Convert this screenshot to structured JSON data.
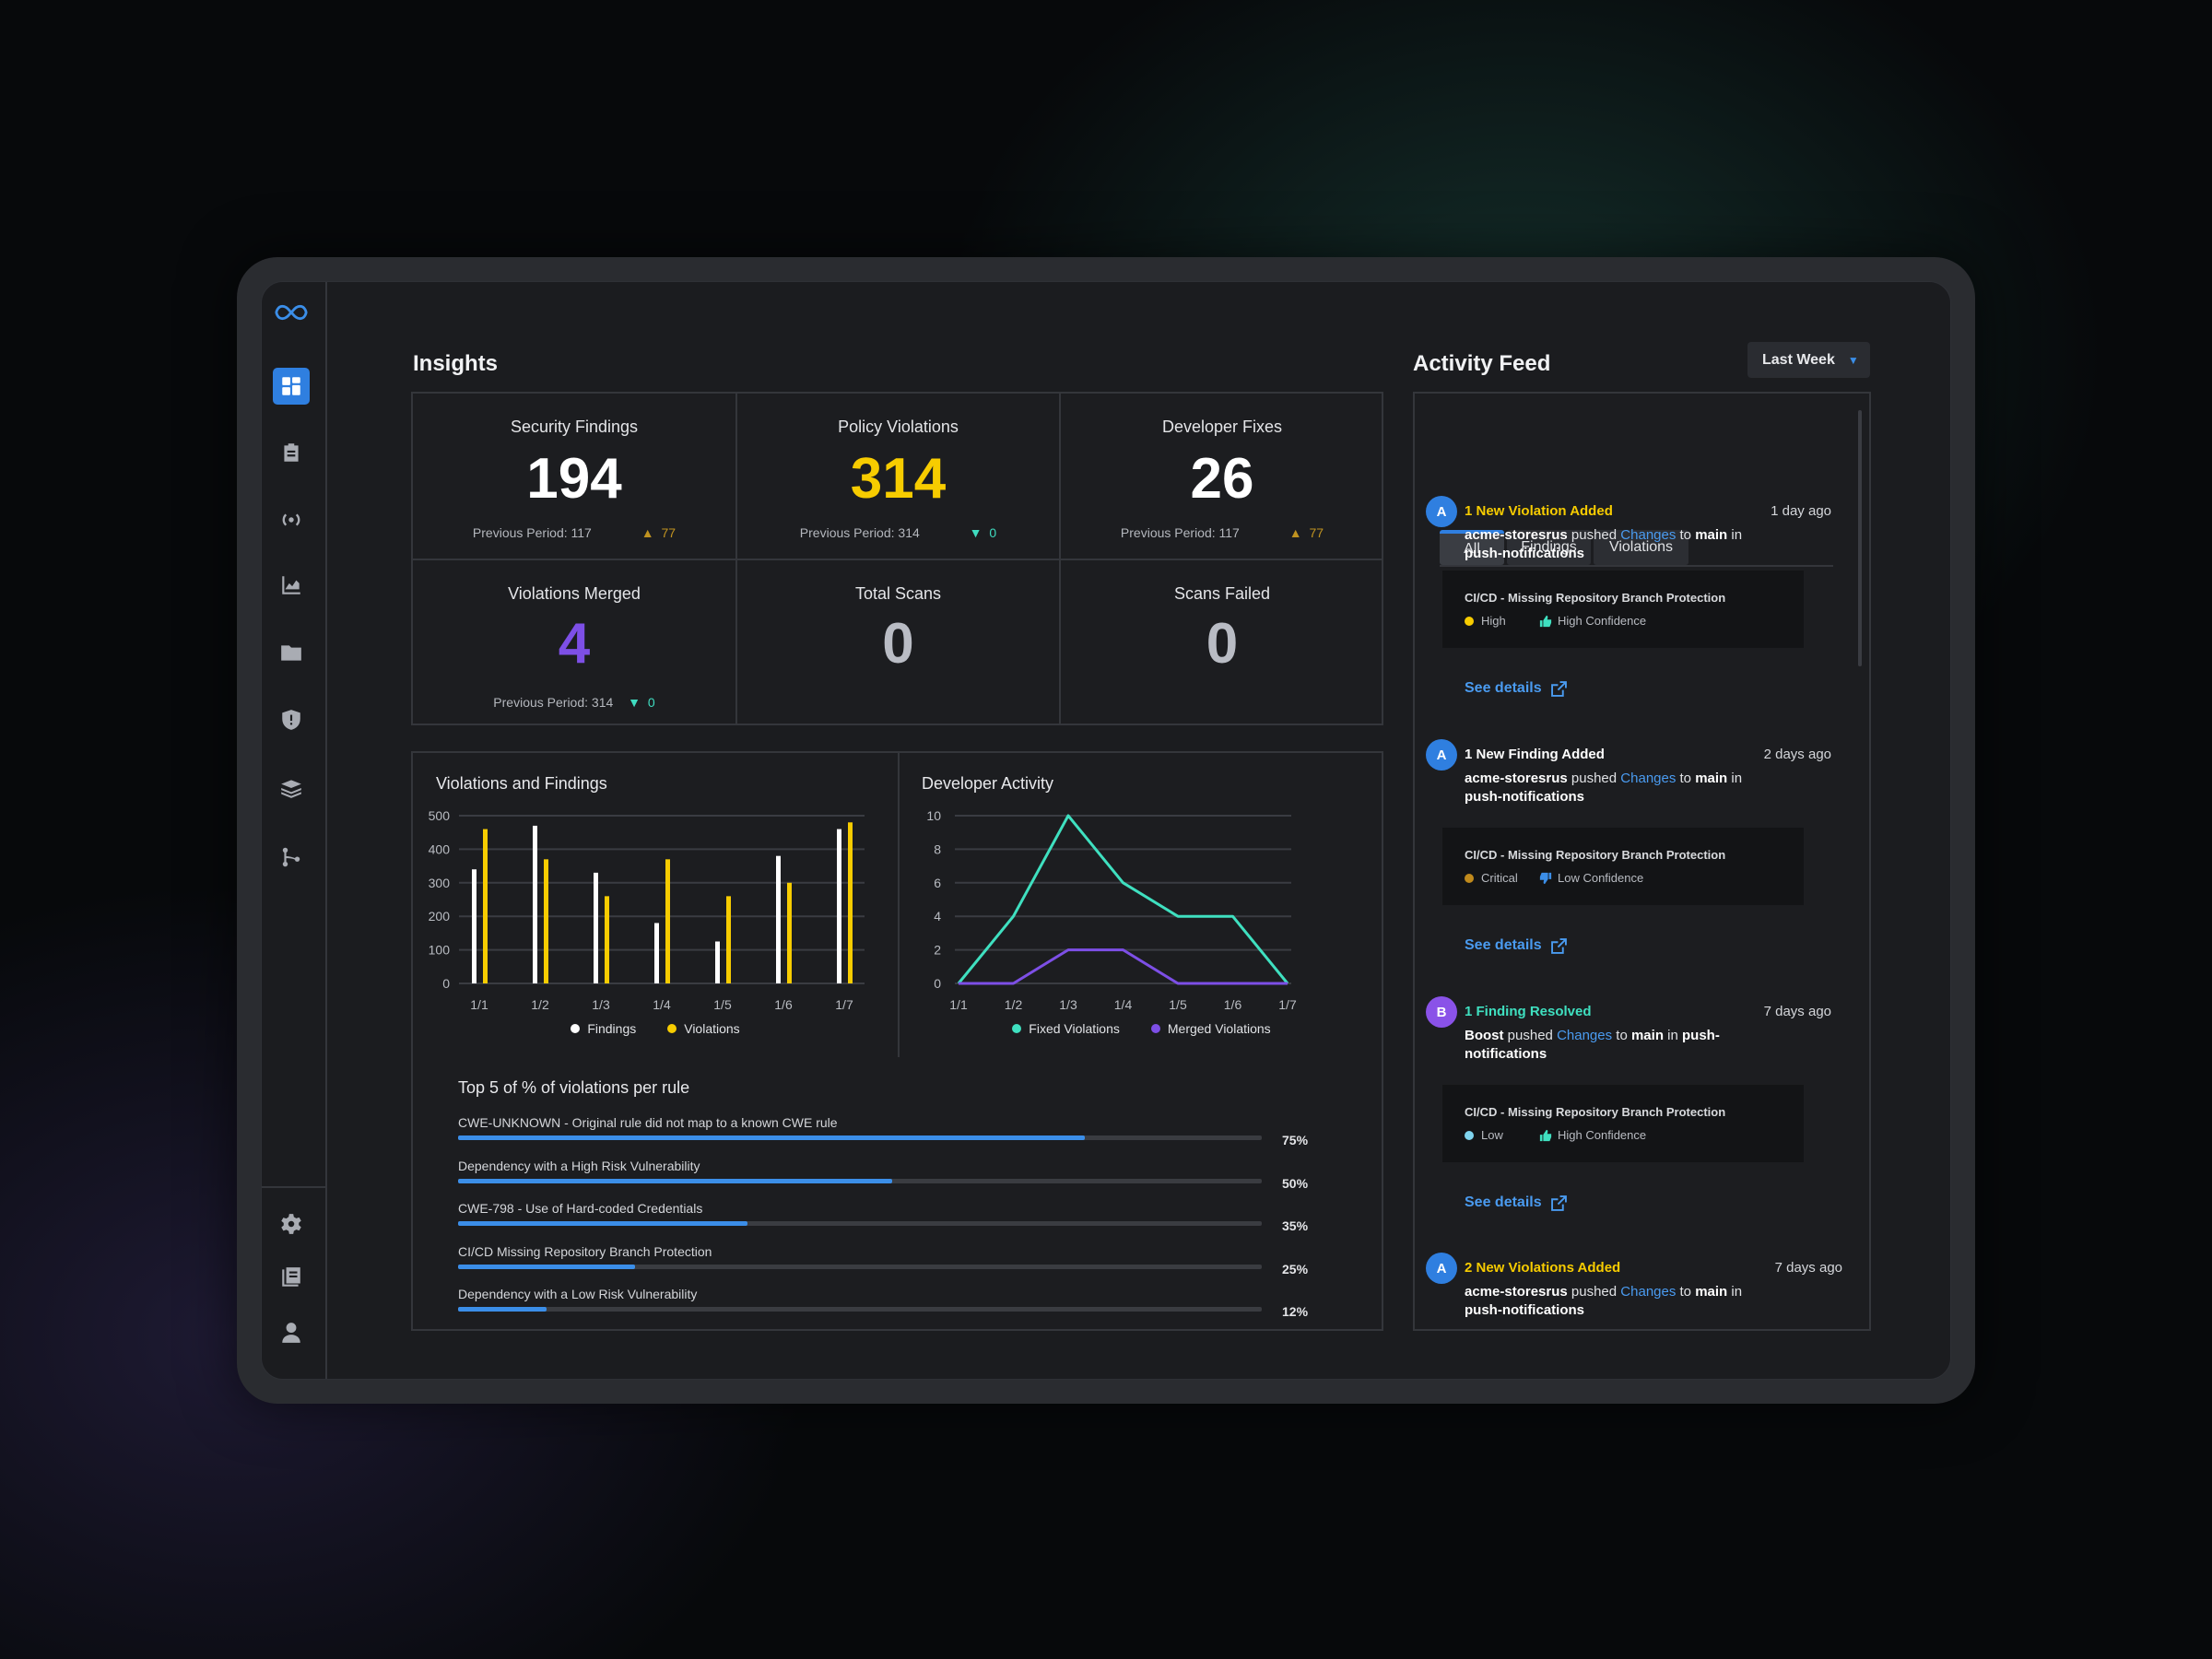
{
  "sidebar": {
    "items": [
      {
        "icon": "infinity-logo-icon"
      },
      {
        "icon": "dashboard-icon",
        "active": true
      },
      {
        "icon": "clipboard-icon"
      },
      {
        "icon": "broadcast-icon"
      },
      {
        "icon": "chart-icon"
      },
      {
        "icon": "folder-icon"
      },
      {
        "icon": "shield-alert-icon"
      },
      {
        "icon": "layers-icon"
      },
      {
        "icon": "branch-icon"
      }
    ],
    "bottom": [
      {
        "icon": "gear-icon"
      },
      {
        "icon": "documents-icon"
      },
      {
        "icon": "user-icon"
      }
    ]
  },
  "insights": {
    "title": "Insights",
    "kpis": [
      {
        "title": "Security Findings",
        "value": "194",
        "color": "#ffffff",
        "previous": "Previous Period: 117",
        "delta": "77",
        "trend": "up"
      },
      {
        "title": "Policy Violations",
        "value": "314",
        "color": "#f7cc00",
        "previous": "Previous Period: 314",
        "delta": "0",
        "trend": "down"
      },
      {
        "title": "Developer Fixes",
        "value": "26",
        "color": "#ffffff",
        "previous": "Previous Period: 117",
        "delta": "77",
        "trend": "up"
      },
      {
        "title": "Violations Merged",
        "value": "4",
        "color": "#7d4fe6",
        "previous": "Previous Period: 314",
        "delta": "0",
        "trend": "down"
      },
      {
        "title": "Total Scans",
        "value": "0",
        "color": "#b9bcc4"
      },
      {
        "title": "Scans Failed",
        "value": "0",
        "color": "#b9bcc4"
      }
    ]
  },
  "chart_data": [
    {
      "type": "bar",
      "title": "Violations and Findings",
      "categories": [
        "1/1",
        "1/2",
        "1/3",
        "1/4",
        "1/5",
        "1/6",
        "1/7"
      ],
      "series": [
        {
          "name": "Findings",
          "color": "#ffffff",
          "values": [
            340,
            470,
            330,
            180,
            125,
            380,
            460
          ]
        },
        {
          "name": "Violations",
          "color": "#f7cc00",
          "values": [
            460,
            370,
            260,
            370,
            260,
            300,
            480
          ]
        }
      ],
      "ylim": [
        0,
        500
      ],
      "yticks": [
        0,
        100,
        200,
        300,
        400,
        500
      ],
      "grid": true,
      "legend": "bottom"
    },
    {
      "type": "line",
      "title": "Developer Activity",
      "categories": [
        "1/1",
        "1/2",
        "1/3",
        "1/4",
        "1/5",
        "1/6",
        "1/7"
      ],
      "series": [
        {
          "name": "Fixed Violations",
          "color": "#3fe0c0",
          "values": [
            0,
            4,
            10,
            6,
            4,
            4,
            0
          ]
        },
        {
          "name": "Merged Violations",
          "color": "#7d4fe6",
          "values": [
            0,
            0,
            2,
            2,
            0,
            0,
            0
          ]
        }
      ],
      "ylim": [
        0,
        10
      ],
      "yticks": [
        0,
        2,
        4,
        6,
        8,
        10
      ],
      "grid": true,
      "legend": "bottom"
    }
  ],
  "top_rules": {
    "title": "Top 5 of % of violations per rule",
    "items": [
      {
        "label": "CWE-UNKNOWN - Original rule did not map to a known CWE rule",
        "percent": 78,
        "percent_label": "75%"
      },
      {
        "label": "Dependency with a High Risk Vulnerability",
        "percent": 54,
        "percent_label": "50%"
      },
      {
        "label": "CWE-798 - Use of Hard-coded Credentials",
        "percent": 36,
        "percent_label": "35%"
      },
      {
        "label": "CI/CD Missing Repository Branch Protection",
        "percent": 22,
        "percent_label": "25%"
      },
      {
        "label": "Dependency with a Low Risk Vulnerability",
        "percent": 11,
        "percent_label": "12%"
      }
    ]
  },
  "feed": {
    "title": "Activity Feed",
    "range": "Last Week",
    "tabs": [
      {
        "label": "All",
        "active": true
      },
      {
        "label": "Findings"
      },
      {
        "label": "Violations"
      }
    ],
    "see_details": "See details",
    "items": [
      {
        "avatar": "A",
        "avatar_color": "#2f7fe0",
        "title": "1 New Violation Added",
        "title_color": "#f7cc00",
        "time": "1 day ago",
        "actor": "acme-storesrus",
        "verb": "pushed",
        "link": "Changes",
        "to": "to",
        "branch": "main",
        "in": "in",
        "repo": "push-notifications",
        "rule": "CI/CD - Missing Repository Branch Protection",
        "severity": "High",
        "severity_color": "#f7cc00",
        "confidence": "High Confidence",
        "confidence_icon": "thumbs-up-icon"
      },
      {
        "avatar": "A",
        "avatar_color": "#2f7fe0",
        "title": "1 New Finding Added",
        "title_color": "#ffffff",
        "time": "2 days ago",
        "actor": "acme-storesrus",
        "verb": "pushed",
        "link": "Changes",
        "to": "to",
        "branch": "main",
        "in": "in",
        "repo": "push-notifications",
        "rule": "CI/CD - Missing Repository Branch Protection",
        "severity": "Critical",
        "severity_color": "#c08a1c",
        "confidence": "Low Confidence",
        "confidence_icon": "thumbs-down-icon"
      },
      {
        "avatar": "B",
        "avatar_color": "#8a52e8",
        "title": "1 Finding Resolved",
        "title_color": "#3fe0c0",
        "time": "7 days ago",
        "actor": "Boost",
        "verb": "pushed",
        "link": "Changes",
        "to": "to",
        "branch": "main",
        "in": "in",
        "repo": "push-notifications",
        "rule": "CI/CD - Missing Repository Branch Protection",
        "severity": "Low",
        "severity_color": "#7fd4ee",
        "confidence": "High Confidence",
        "confidence_icon": "thumbs-up-icon"
      },
      {
        "avatar": "A",
        "avatar_color": "#2f7fe0",
        "title": "2 New Violations Added",
        "title_color": "#f7cc00",
        "time": "7 days ago",
        "actor": "acme-storesrus",
        "verb": "pushed",
        "link": "Changes",
        "to": "to",
        "branch": "main",
        "in": "in",
        "repo": "push-notifications"
      }
    ]
  }
}
